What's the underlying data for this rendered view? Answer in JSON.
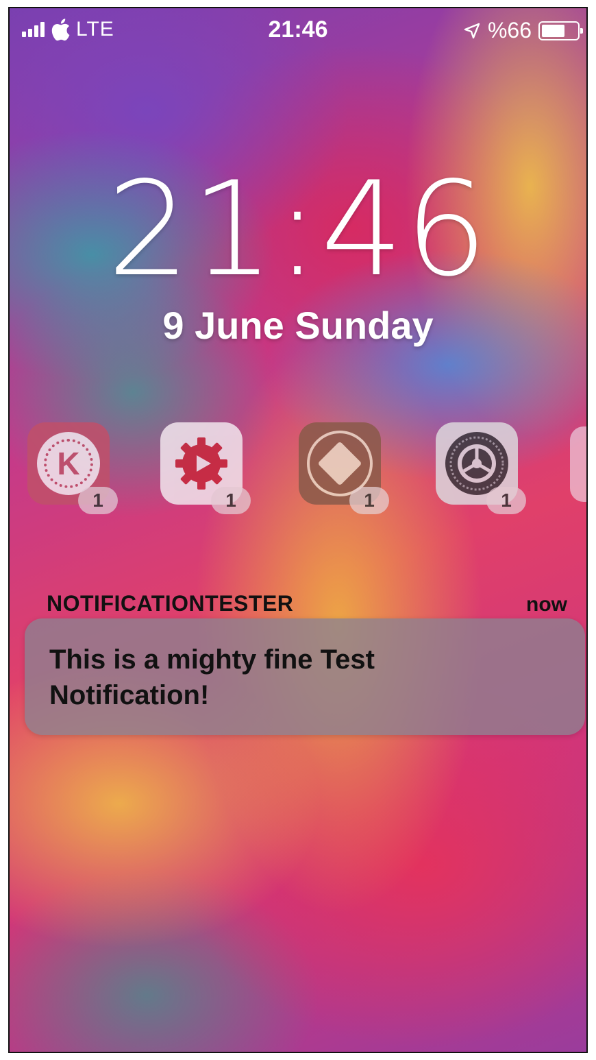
{
  "status_bar": {
    "signal_bars": 4,
    "carrier_icon": "apple-logo-icon",
    "network_type": "LTE",
    "time": "21:46",
    "location_icon": "location-arrow-icon",
    "battery_percent_text": "%66",
    "battery_level": 0.66
  },
  "lock_screen": {
    "time": "21:46",
    "date": "9 June Sunday"
  },
  "app_icons": [
    {
      "name": "kinemaster-icon",
      "glyph": "K",
      "badge": "1"
    },
    {
      "name": "toolbox-gear-play-icon",
      "badge": "1"
    },
    {
      "name": "cydia-icon",
      "badge": "1"
    },
    {
      "name": "settings-icon",
      "badge": "1"
    }
  ],
  "notification": {
    "app_name": "NOTIFICATIONTESTER",
    "time": "now",
    "body_line1": "This is a mighty fine Test",
    "body_line2": "Notification!"
  },
  "colors": {
    "notification_card": "#8c8291",
    "text_white": "#ffffff"
  }
}
